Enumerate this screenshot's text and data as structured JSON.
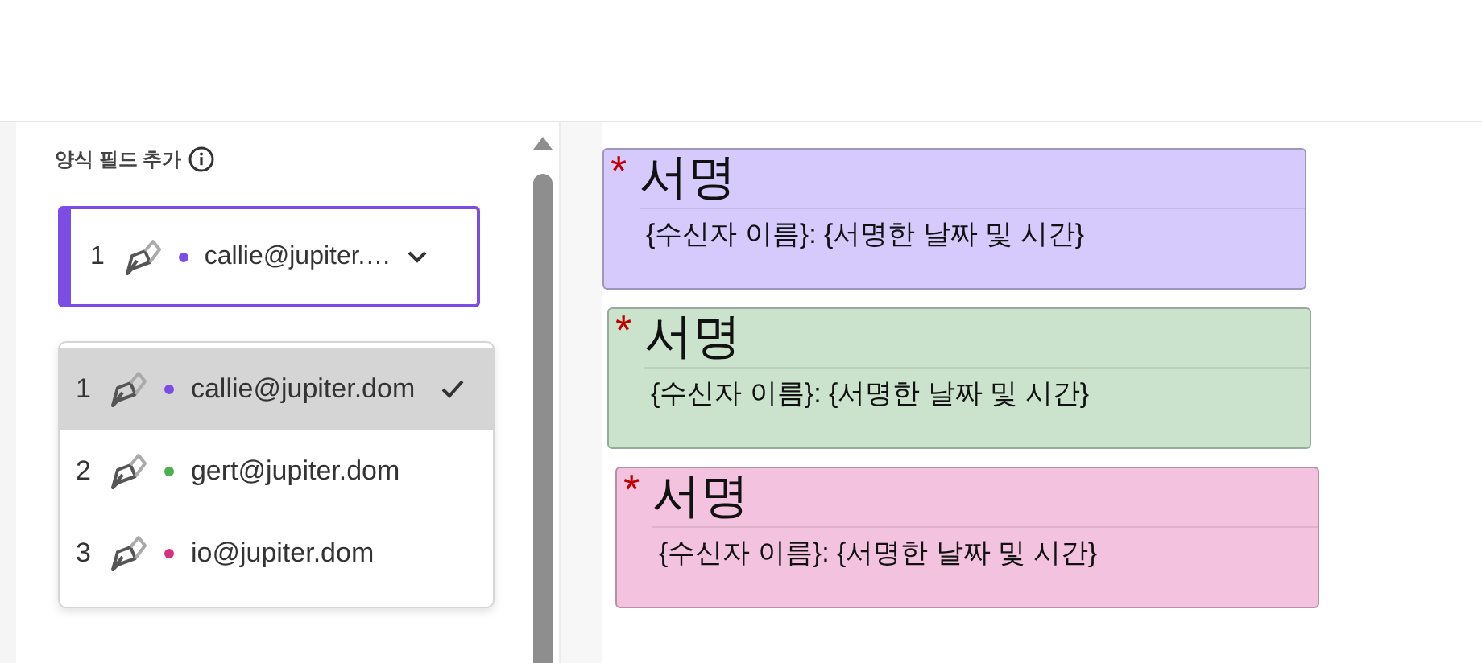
{
  "panel": {
    "title": "양식 필드 추가"
  },
  "select": {
    "number": "1",
    "email": "callie@jupiter.…",
    "color": "#7b4ce6",
    "focused": true
  },
  "options": [
    {
      "number": "1",
      "email": "callie@jupiter.dom",
      "color": "#7b4ce6",
      "selected": true
    },
    {
      "number": "2",
      "email": "gert@jupiter.dom",
      "color": "#4caf50",
      "selected": false
    },
    {
      "number": "3",
      "email": "io@jupiter.dom",
      "color": "#d6307e",
      "selected": false
    }
  ],
  "fields": [
    {
      "required_mark": "*",
      "label": "서명",
      "caption": "{수신자 이름}: {서명한 날짜 및 시간}",
      "color": "#d6c9fb"
    },
    {
      "required_mark": "*",
      "label": "서명",
      "caption": "{수신자 이름}: {서명한 날짜 및 시간}",
      "color": "#cbe3cd"
    },
    {
      "required_mark": "*",
      "label": "서명",
      "caption": "{수신자 이름}: {서명한 날짜 및 시간}",
      "color": "#f2c2de"
    }
  ]
}
